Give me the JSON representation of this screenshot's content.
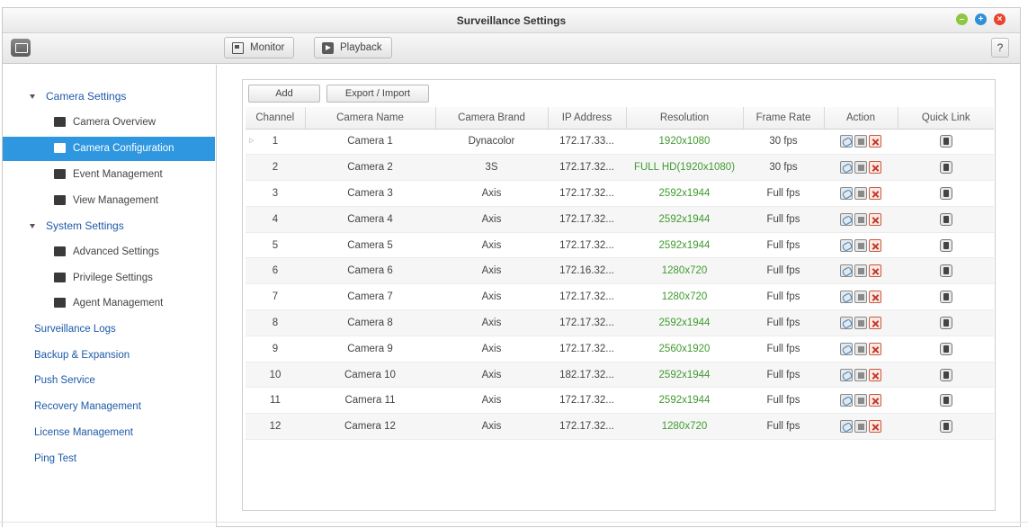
{
  "window": {
    "title": "Surveillance Settings",
    "controls": [
      "minimize-icon",
      "maximize-icon",
      "close-icon"
    ],
    "accent_color": "#2e97e0",
    "status_green": "#3f9b2e"
  },
  "toolbar": {
    "monitor_label": "Monitor",
    "playback_label": "Playback",
    "help_label": "?"
  },
  "sidebar": {
    "camera_settings": "Camera Settings",
    "camera_overview": "Camera Overview",
    "camera_configuration": "Camera Configuration",
    "event_management": "Event Management",
    "view_management": "View Management",
    "system_settings": "System Settings",
    "advanced_settings": "Advanced Settings",
    "privilege_settings": "Privilege Settings",
    "agent_management": "Agent Management",
    "surveillance_logs": "Surveillance Logs",
    "backup_expansion": "Backup & Expansion",
    "push_service": "Push Service",
    "recovery_management": "Recovery Management",
    "license_management": "License Management",
    "ping_test": "Ping Test"
  },
  "content": {
    "add_label": "Add",
    "export_import_label": "Export / Import",
    "columns": [
      "Channel",
      "Camera Name",
      "Camera Brand",
      "IP Address",
      "Resolution",
      "Frame Rate",
      "Action",
      "Quick Link"
    ],
    "rows": [
      {
        "channel": "1",
        "name": "Camera 1",
        "brand": "Dynacolor",
        "ip": "172.17.33...",
        "resolution": "1920x1080",
        "fps": "30 fps"
      },
      {
        "channel": "2",
        "name": "Camera 2",
        "brand": "3S",
        "ip": "172.17.32...",
        "resolution": "FULL HD(1920x1080)",
        "fps": "30 fps"
      },
      {
        "channel": "3",
        "name": "Camera 3",
        "brand": "Axis",
        "ip": "172.17.32...",
        "resolution": "2592x1944",
        "fps": "Full fps"
      },
      {
        "channel": "4",
        "name": "Camera 4",
        "brand": "Axis",
        "ip": "172.17.32...",
        "resolution": "2592x1944",
        "fps": "Full fps"
      },
      {
        "channel": "5",
        "name": "Camera 5",
        "brand": "Axis",
        "ip": "172.17.32...",
        "resolution": "2592x1944",
        "fps": "Full fps"
      },
      {
        "channel": "6",
        "name": "Camera 6",
        "brand": "Axis",
        "ip": "172.16.32...",
        "resolution": "1280x720",
        "fps": "Full fps"
      },
      {
        "channel": "7",
        "name": "Camera 7",
        "brand": "Axis",
        "ip": "172.17.32...",
        "resolution": "1280x720",
        "fps": "Full fps"
      },
      {
        "channel": "8",
        "name": "Camera 8",
        "brand": "Axis",
        "ip": "172.17.32...",
        "resolution": "2592x1944",
        "fps": "Full fps"
      },
      {
        "channel": "9",
        "name": "Camera 9",
        "brand": "Axis",
        "ip": "172.17.32...",
        "resolution": "2560x1920",
        "fps": "Full fps"
      },
      {
        "channel": "10",
        "name": "Camera 10",
        "brand": "Axis",
        "ip": "182.17.32...",
        "resolution": "2592x1944",
        "fps": "Full fps"
      },
      {
        "channel": "11",
        "name": "Camera 11",
        "brand": "Axis",
        "ip": "172.17.32...",
        "resolution": "2592x1944",
        "fps": "Full fps"
      },
      {
        "channel": "12",
        "name": "Camera 12",
        "brand": "Axis",
        "ip": "172.17.32...",
        "resolution": "1280x720",
        "fps": "Full fps"
      }
    ]
  }
}
